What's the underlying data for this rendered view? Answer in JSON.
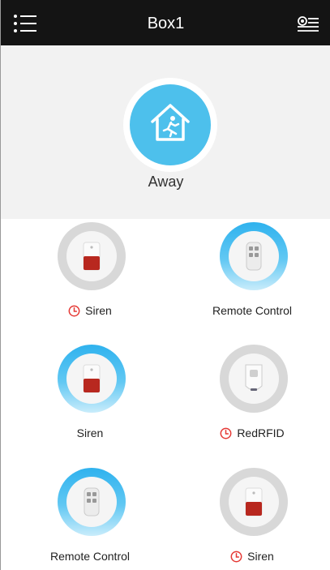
{
  "header": {
    "title": "Box1",
    "menu_icon": "list-menu-icon",
    "settings_icon": "box-settings-icon"
  },
  "mode": {
    "label": "Away",
    "icon": "house-away-icon",
    "color": "#4dc0ec"
  },
  "devices": [
    {
      "label": "Siren",
      "type": "siren",
      "active": false,
      "timer": true
    },
    {
      "label": "Remote Control",
      "type": "remote",
      "active": true,
      "timer": false
    },
    {
      "label": "Siren",
      "type": "siren",
      "active": true,
      "timer": false
    },
    {
      "label": "RedRFID",
      "type": "rfid",
      "active": false,
      "timer": true
    },
    {
      "label": "Remote Control",
      "type": "remote",
      "active": true,
      "timer": false
    },
    {
      "label": "Siren",
      "type": "siren",
      "active": false,
      "timer": true
    }
  ],
  "colors": {
    "header_bg": "#141414",
    "active_ring": "#2fb2ee",
    "inactive_ring": "#d8d8d8",
    "timer_icon": "#e53935"
  }
}
